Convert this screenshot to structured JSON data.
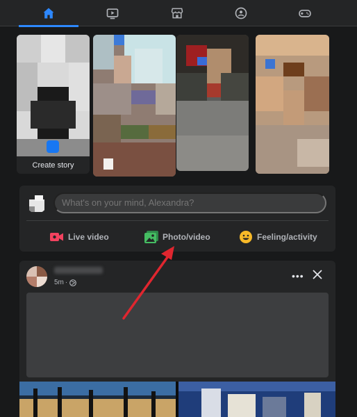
{
  "nav": {
    "tabs": [
      {
        "name": "home",
        "active": true
      },
      {
        "name": "watch",
        "active": false
      },
      {
        "name": "marketplace",
        "active": false
      },
      {
        "name": "groups",
        "active": false
      },
      {
        "name": "gaming",
        "active": false
      }
    ]
  },
  "stories": {
    "create_label": "Create story"
  },
  "composer": {
    "placeholder": "What's on your mind, Alexandra?",
    "actions": {
      "live": "Live video",
      "photo": "Photo/video",
      "feeling": "Feeling/activity"
    }
  },
  "post": {
    "time": "5m",
    "more_icon": "more-dots-icon",
    "close_icon": "close-icon"
  },
  "colors": {
    "accent": "#2d88ff",
    "live_red": "#f3425f",
    "photo_green": "#45bd62",
    "feeling_yellow": "#f7b928",
    "arrow_red": "#e0262f"
  }
}
